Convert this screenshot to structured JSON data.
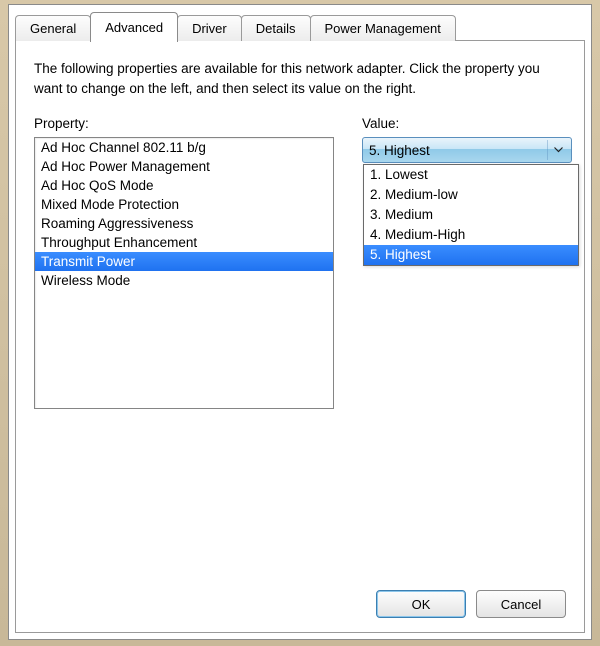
{
  "tabs": {
    "general": "General",
    "advanced": "Advanced",
    "driver": "Driver",
    "details": "Details",
    "power": "Power Management",
    "active": "advanced"
  },
  "description": "The following properties are available for this network adapter. Click the property you want to change on the left, and then select its value on the right.",
  "labels": {
    "property": "Property:",
    "value": "Value:"
  },
  "properties": [
    "Ad Hoc Channel 802.11 b/g",
    "Ad Hoc Power Management",
    "Ad Hoc QoS Mode",
    "Mixed Mode Protection",
    "Roaming Aggressiveness",
    "Throughput Enhancement",
    "Transmit Power",
    "Wireless Mode"
  ],
  "properties_selected_index": 6,
  "value_selected": "5. Highest",
  "value_options": [
    "1. Lowest",
    "2. Medium-low",
    "3. Medium",
    "4. Medium-High",
    "5. Highest"
  ],
  "value_options_selected_index": 4,
  "buttons": {
    "ok": "OK",
    "cancel": "Cancel"
  }
}
